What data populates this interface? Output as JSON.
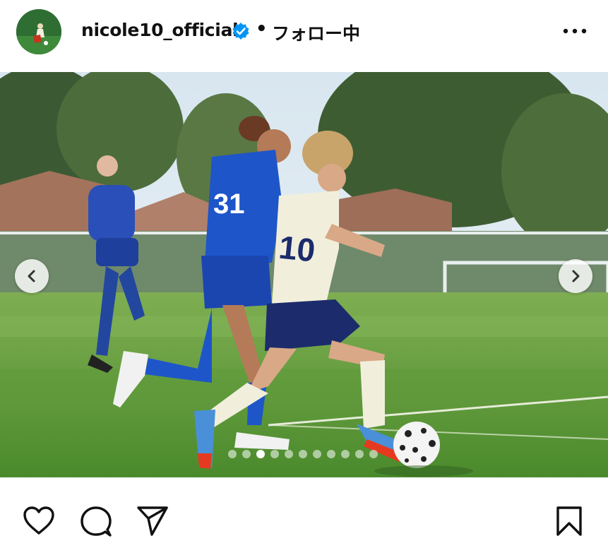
{
  "post": {
    "username": "nicole10_official",
    "separator": "•",
    "follow_status": "フォロー中",
    "verified": true
  },
  "icons": {
    "avatar": "profile-photo",
    "verified": "verified-badge-icon",
    "more": "more-options-icon",
    "prev": "chevron-left-icon",
    "next": "chevron-right-icon",
    "like": "heart-icon",
    "comment": "comment-bubble-icon",
    "share": "paper-plane-icon",
    "save": "bookmark-icon"
  },
  "carousel": {
    "total_slides": 11,
    "current_slide": 3
  },
  "colors": {
    "verified_blue": "#0095f6",
    "text": "#111111",
    "home_kit": "#1e55c9",
    "away_kit": "#f1efdc",
    "shorts": "#1c2b6b",
    "pitch": "#4f8c2d"
  }
}
